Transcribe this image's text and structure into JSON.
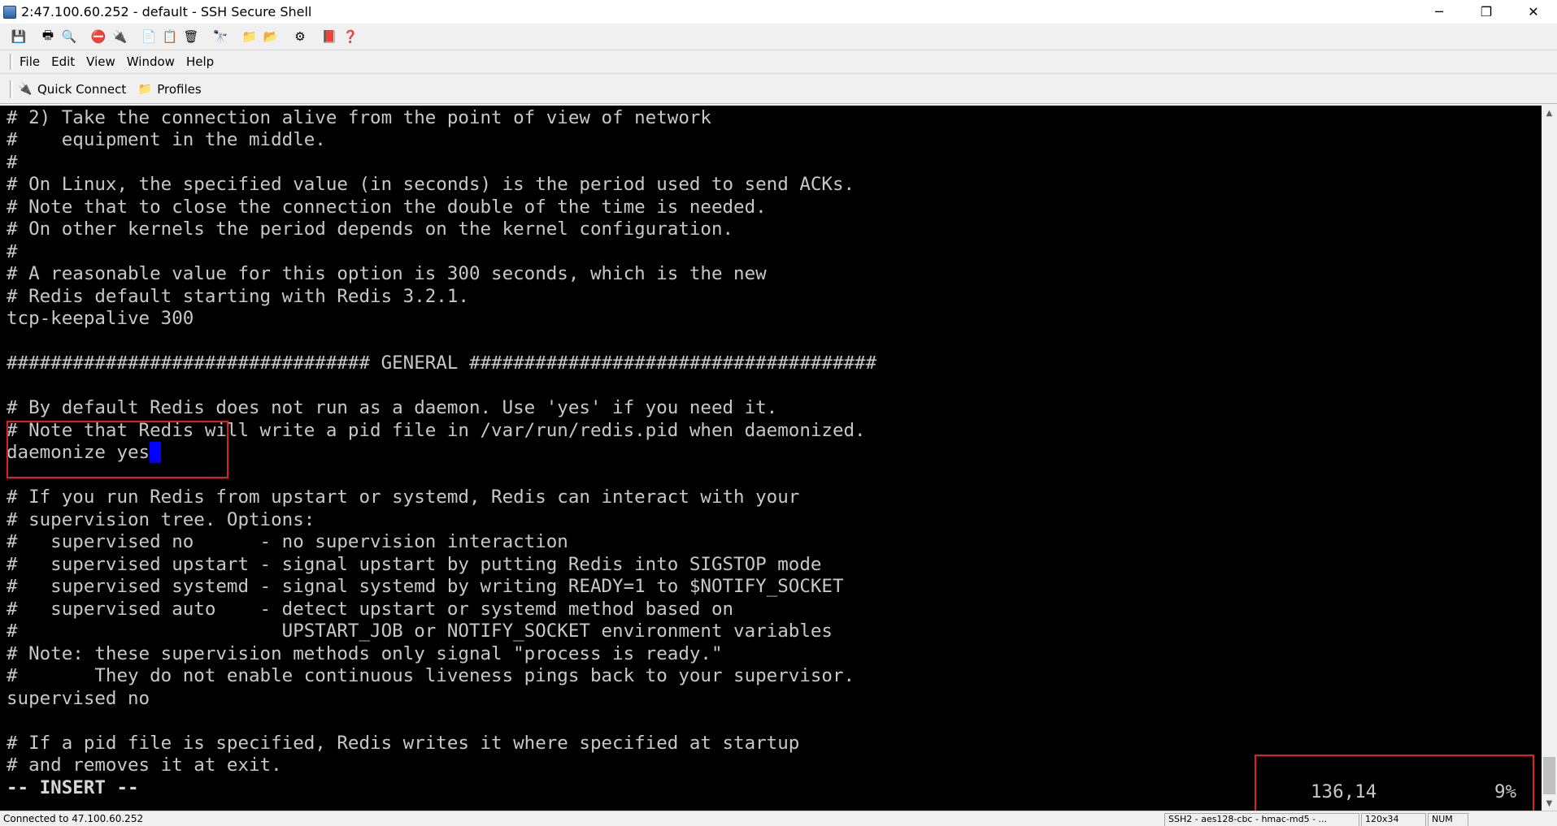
{
  "window": {
    "title": "2:47.100.60.252 - default - SSH Secure Shell",
    "minimize_glyph": "─",
    "restore_glyph": "❐",
    "close_glyph": "✕"
  },
  "toolbar": {
    "icons": [
      "save-icon",
      "print-icon",
      "print-preview-icon",
      "disconnect-icon",
      "new-connection-icon",
      "copy-icon",
      "paste-icon",
      "clear-icon",
      "find-icon",
      "sftp-icon",
      "settings-icon",
      "keys-icon",
      "help-book-icon",
      "context-help-icon"
    ],
    "glyphs": [
      "💾",
      "🖶",
      "🔍",
      "⛔",
      "🔌",
      "📄",
      "📋",
      "🗑",
      "🔭",
      "📁",
      "📂",
      "⚙",
      "📕",
      "❓"
    ]
  },
  "menu": {
    "items": [
      "File",
      "Edit",
      "View",
      "Window",
      "Help"
    ]
  },
  "connection_bar": {
    "quick_connect": "Quick Connect",
    "profiles": "Profiles"
  },
  "terminal": {
    "lines": [
      "# 2) Take the connection alive from the point of view of network",
      "#    equipment in the middle.",
      "#",
      "# On Linux, the specified value (in seconds) is the period used to send ACKs.",
      "# Note that to close the connection the double of the time is needed.",
      "# On other kernels the period depends on the kernel configuration.",
      "#",
      "# A reasonable value for this option is 300 seconds, which is the new",
      "# Redis default starting with Redis 3.2.1.",
      "tcp-keepalive 300",
      "",
      "################################# GENERAL #####################################",
      "",
      "# By default Redis does not run as a daemon. Use 'yes' if you need it.",
      "# Note that Redis will write a pid file in /var/run/redis.pid when daemonized.",
      "daemonize yes",
      "",
      "# If you run Redis from upstart or systemd, Redis can interact with your",
      "# supervision tree. Options:",
      "#   supervised no      - no supervision interaction",
      "#   supervised upstart - signal upstart by putting Redis into SIGSTOP mode",
      "#   supervised systemd - signal systemd by writing READY=1 to $NOTIFY_SOCKET",
      "#   supervised auto    - detect upstart or systemd method based on",
      "#                        UPSTART_JOB or NOTIFY_SOCKET environment variables",
      "# Note: these supervision methods only signal \"process is ready.\"",
      "#       They do not enable continuous liveness pings back to your supervisor.",
      "supervised no",
      "",
      "# If a pid file is specified, Redis writes it where specified at startup",
      "# and removes it at exit."
    ],
    "mode": "-- INSERT --",
    "cursor_position": "136,14",
    "scroll_percent": "9%"
  },
  "statusbar": {
    "left_text": "Connected to 47.100.60.252",
    "panels": [
      "SSH2 - aes128-cbc - hmac-md5 - ...",
      "120x34",
      "NUM"
    ]
  }
}
